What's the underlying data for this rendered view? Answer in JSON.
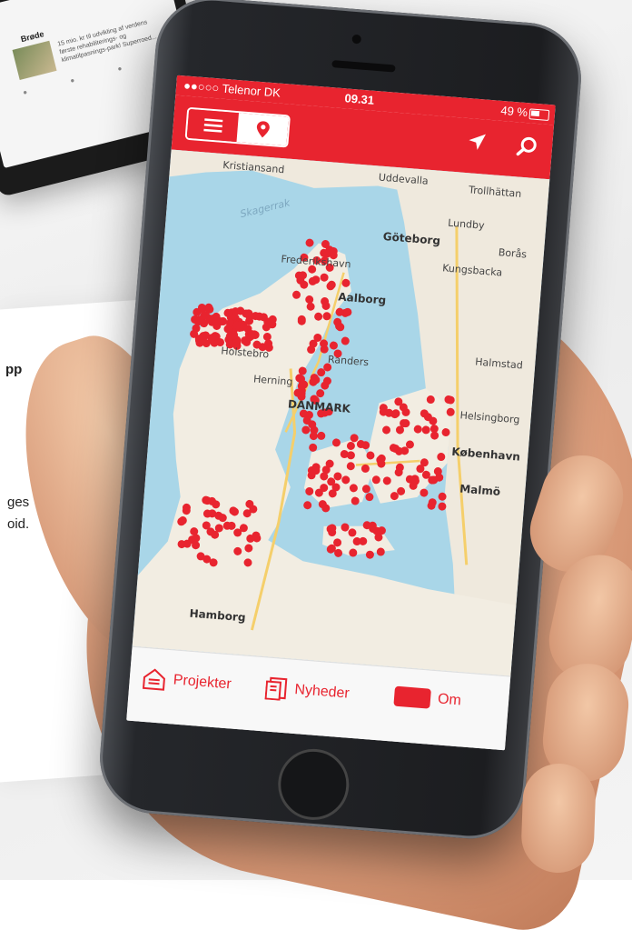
{
  "background": {
    "side_text": [
      "pp",
      "ges",
      "oid."
    ]
  },
  "laptop": {
    "post_name": "Brøde",
    "post_text": "15 mio. kr til udvikling af verdens første rehabiliterings- og klimatilpasnings-park! Superroed..."
  },
  "phone": {
    "status": {
      "carrier": "●●○○○ Telenor DK",
      "time": "09.31",
      "battery": "49 %"
    },
    "nav": {
      "list_icon": "list-icon",
      "map_icon": "map-pin-icon",
      "location_icon": "location-arrow-icon",
      "search_icon": "search-icon",
      "accent": "#e8242f"
    },
    "map": {
      "marker_color": "#e8242f",
      "labels": [
        "Kristiansand",
        "Skagerrak",
        "Uddevalla",
        "Trollhättan",
        "Lundby",
        "Göteborg",
        "Borås",
        "Kungsbacka",
        "Frederikshavn",
        "Aalborg",
        "Halmstad",
        "Holstebro",
        "Randers",
        "Herning",
        "DANMARK",
        "Helsingborg",
        "København",
        "Malmö",
        "Hamborg"
      ]
    },
    "tabs": [
      {
        "label": "Projekter",
        "icon": "house-icon"
      },
      {
        "label": "Nyheder",
        "icon": "news-icon"
      },
      {
        "label": "Om",
        "icon": "brand-logo-icon"
      }
    ]
  }
}
